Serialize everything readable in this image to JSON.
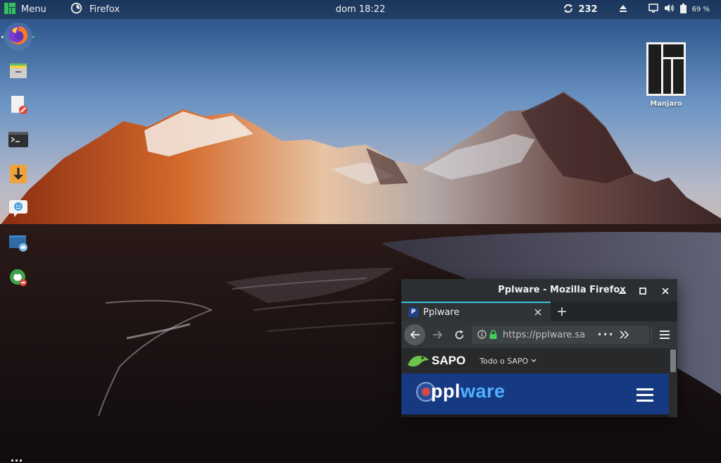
{
  "top_panel": {
    "menu_label": "Menu",
    "menu_icon": "manjaro-logo-icon",
    "active_app_icon": "firefox-icon",
    "active_app_label": "Firefox",
    "clock": "dom 18:22",
    "updates_icon": "update-sync-icon",
    "updates_count": "232",
    "eject_icon": "eject-icon",
    "display_icon": "display-icon",
    "volume_icon": "volume-icon",
    "battery_icon": "battery-icon",
    "battery_percent": "69 %"
  },
  "dock": {
    "items": [
      {
        "name": "firefox",
        "icon": "firefox-icon",
        "active": true
      },
      {
        "name": "file-manager",
        "icon": "file-manager-icon",
        "active": false
      },
      {
        "name": "text-editor",
        "icon": "text-editor-icon",
        "active": false
      },
      {
        "name": "terminal",
        "icon": "terminal-icon",
        "active": false
      },
      {
        "name": "downloader",
        "icon": "download-icon",
        "active": false
      },
      {
        "name": "chat",
        "icon": "chat-icon",
        "active": false
      },
      {
        "name": "screenshot",
        "icon": "screenshot-icon",
        "active": false
      },
      {
        "name": "software-manager",
        "icon": "software-manager-icon",
        "active": false
      }
    ],
    "apps_grid_icon": "apps-grid-icon"
  },
  "desktop": {
    "icon": "manjaro-logo-icon",
    "label": "Manjaro"
  },
  "firefox_window": {
    "title": "Pplware - Mozilla Firefox",
    "tab": {
      "title": "Pplware",
      "favicon_letter": "P"
    },
    "url": "https://pplware.sa",
    "url_more": "•••",
    "page": {
      "sapo_brand": "SAPO",
      "sapo_menu": "Todo o SAPO",
      "site_logo_primary": "ppl",
      "site_logo_accent": "ware"
    }
  },
  "colors": {
    "tab_accent": "#39c3e6",
    "lock_green": "#3fcf5b",
    "sapo_green": "#6cc24a",
    "pplware_blue": "#163a82",
    "pplware_accent": "#4fb0ff",
    "manjaro_green": "#35bf5c"
  }
}
